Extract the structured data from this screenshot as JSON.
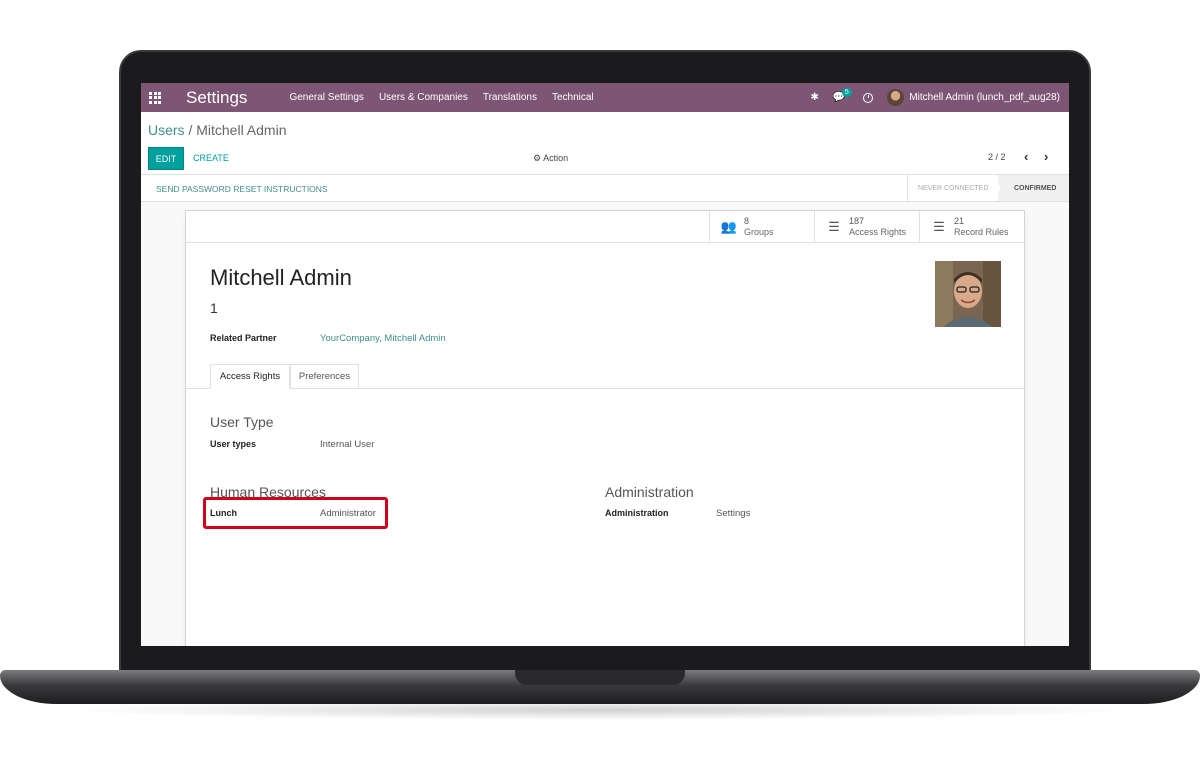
{
  "navbar": {
    "app_title": "Settings",
    "menu": [
      "General Settings",
      "Users & Companies",
      "Translations",
      "Technical"
    ],
    "message_count": "5",
    "user": "Mitchell Admin (lunch_pdf_aug28)"
  },
  "breadcrumb": {
    "parent": "Users",
    "separator": "/",
    "current": "Mitchell Admin"
  },
  "toolbar": {
    "edit_label": "EDIT",
    "create_label": "CREATE",
    "action_label": "Action",
    "pager": "2 / 2"
  },
  "statusbar": {
    "reset_label": "SEND PASSWORD RESET INSTRUCTIONS",
    "stages": [
      "NEVER CONNECTED",
      "CONFIRMED"
    ],
    "active_stage": "CONFIRMED"
  },
  "stats": [
    {
      "value": "8",
      "label": "Groups",
      "icon": "users-icon"
    },
    {
      "value": "187",
      "label": "Access Rights",
      "icon": "list-icon"
    },
    {
      "value": "21",
      "label": "Record Rules",
      "icon": "list-icon"
    }
  ],
  "form": {
    "name": "Mitchell Admin",
    "login": "1",
    "related_partner_label": "Related Partner",
    "related_partner_value": "YourCompany, Mitchell Admin"
  },
  "tabs": [
    "Access Rights",
    "Preferences"
  ],
  "sections": {
    "user_type": {
      "title": "User Type",
      "label": "User types",
      "value": "Internal User"
    },
    "human_resources": {
      "title": "Human Resources",
      "label": "Lunch",
      "value": "Administrator"
    },
    "administration": {
      "title": "Administration",
      "label": "Administration",
      "value": "Settings"
    }
  },
  "colors": {
    "navbar": "#7c5674",
    "accent": "#00a09d",
    "highlight": "#d0021b"
  }
}
